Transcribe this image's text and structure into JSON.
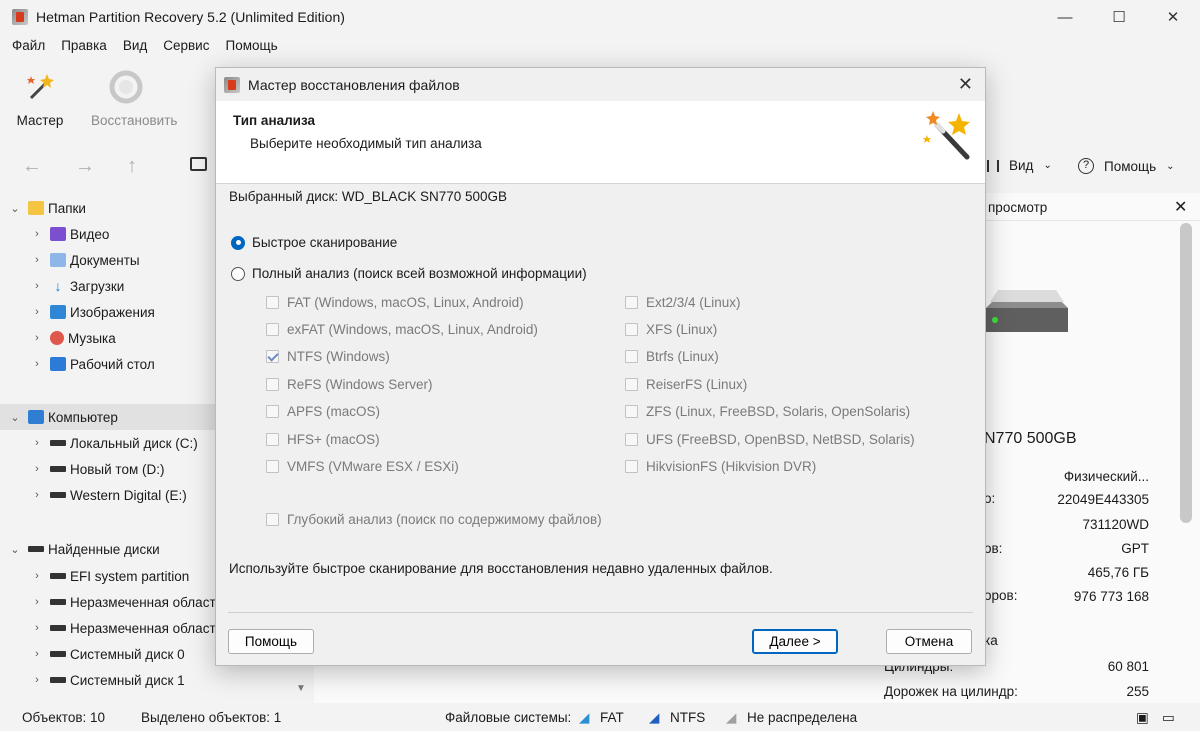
{
  "app": {
    "title": "Hetman Partition Recovery 5.2 (Unlimited Edition)",
    "window_controls": [
      "—",
      "☐",
      "✕"
    ]
  },
  "menu": [
    "Файл",
    "Правка",
    "Вид",
    "Сервис",
    "Помощь"
  ],
  "ribbon": {
    "wizard_label": "Мастер",
    "restore_label": "Восстановить",
    "view_label": "Вид",
    "help_label": "Помощь"
  },
  "tree": {
    "folders_label": "Папки",
    "folders": [
      "Видео",
      "Документы",
      "Загрузки",
      "Изображения",
      "Музыка",
      "Рабочий стол"
    ],
    "computer_label": "Компьютер",
    "drives": [
      "Локальный диск (C:)",
      "Новый том (D:)",
      "Western Digital (E:)"
    ],
    "found_label": "Найденные диски",
    "found": [
      "EFI system partition",
      "Неразмеченная область",
      "Неразмеченная область",
      "Системный диск 0",
      "Системный диск 1"
    ]
  },
  "preview": {
    "header": "просмотр",
    "disk_name": "N770 500GB",
    "rows": [
      {
        "label": "",
        "value": "Физический..."
      },
      {
        "label": "о:",
        "value": "22049E443305"
      },
      {
        "label": "",
        "value": "731120WD"
      },
      {
        "label": "ов:",
        "value": "GPT"
      },
      {
        "label": "",
        "value": "465,76 ГБ"
      },
      {
        "label": "оров:",
        "value": "976 773 168"
      },
      {
        "label": "ка",
        "value": ""
      },
      {
        "label": "Цилиндры:",
        "value": "60 801"
      },
      {
        "label": "Дорожек на цилиндр:",
        "value": "255"
      }
    ]
  },
  "status": {
    "objects": "Объектов: 10",
    "selected": "Выделено объектов: 1",
    "fs_label": "Файловые системы:",
    "fat": "FAT",
    "ntfs": "NTFS",
    "unallocated": "Не распределена"
  },
  "dialog": {
    "title": "Мастер восстановления файлов",
    "heading": "Тип анализа",
    "subheading": "Выберите необходимый тип анализа",
    "selected_disk": "Выбранный диск: WD_BLACK SN770 500GB",
    "radio_fast": "Быстрое сканирование",
    "radio_full": "Полный анализ (поиск всей возможной информации)",
    "fs_left": [
      {
        "label": "FAT (Windows, macOS, Linux, Android)",
        "checked": false
      },
      {
        "label": "exFAT (Windows, macOS, Linux, Android)",
        "checked": false
      },
      {
        "label": "NTFS (Windows)",
        "checked": true
      },
      {
        "label": "ReFS (Windows Server)",
        "checked": false
      },
      {
        "label": "APFS (macOS)",
        "checked": false
      },
      {
        "label": "HFS+ (macOS)",
        "checked": false
      },
      {
        "label": "VMFS (VMware ESX / ESXi)",
        "checked": false
      }
    ],
    "fs_right": [
      {
        "label": "Ext2/3/4 (Linux)",
        "checked": false
      },
      {
        "label": "XFS (Linux)",
        "checked": false
      },
      {
        "label": "Btrfs (Linux)",
        "checked": false
      },
      {
        "label": "ReiserFS (Linux)",
        "checked": false
      },
      {
        "label": "ZFS (Linux, FreeBSD, Solaris, OpenSolaris)",
        "checked": false
      },
      {
        "label": "UFS (FreeBSD, OpenBSD, NetBSD, Solaris)",
        "checked": false
      },
      {
        "label": "HikvisionFS (Hikvision DVR)",
        "checked": false
      }
    ],
    "deep": "Глубокий анализ (поиск по содержимому файлов)",
    "hint": "Используйте быстрое сканирование для восстановления недавно удаленных файлов.",
    "btn_help": "Помощь",
    "btn_next": "Далее >",
    "btn_cancel": "Отмена",
    "close": "✕"
  }
}
